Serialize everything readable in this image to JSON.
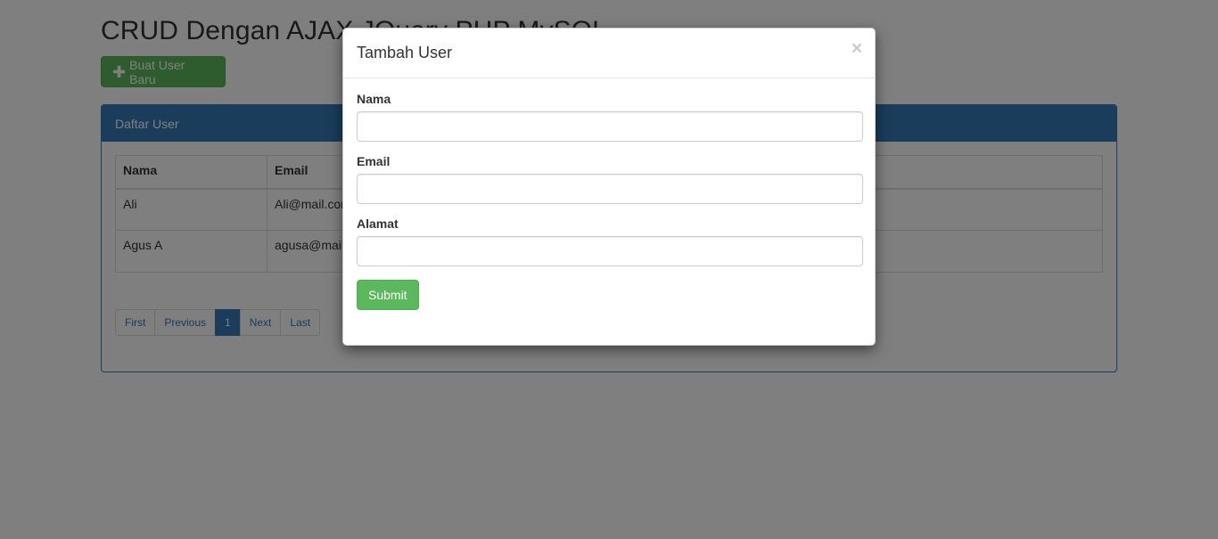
{
  "page": {
    "title": "CRUD Dengan AJAX JQuery PHP MySQL",
    "new_user_button": "Buat User Baru"
  },
  "panel": {
    "heading": "Daftar User",
    "table": {
      "headers": [
        "Nama",
        "Email"
      ],
      "rows": [
        {
          "nama": "Ali",
          "email": "Ali@mail.com"
        },
        {
          "nama": "Agus A",
          "email": "agusa@mail.com"
        }
      ]
    },
    "pagination": {
      "first": "First",
      "previous": "Previous",
      "current": "1",
      "next": "Next",
      "last": "Last"
    }
  },
  "modal": {
    "title": "Tambah User",
    "close": "×",
    "fields": {
      "nama_label": "Nama",
      "nama_value": "",
      "email_label": "Email",
      "email_value": "",
      "alamat_label": "Alamat",
      "alamat_value": ""
    },
    "submit": "Submit"
  },
  "colors": {
    "primary": "#337ab7",
    "success": "#5cb85c",
    "backdrop": "rgba(0,0,0,0.5)"
  }
}
